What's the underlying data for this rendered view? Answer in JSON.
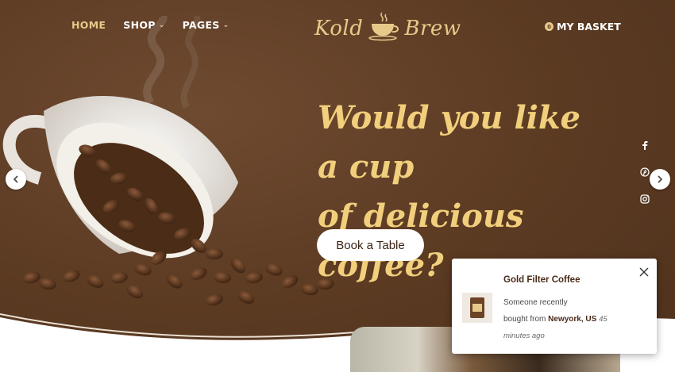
{
  "nav": {
    "items": [
      {
        "label": "HOME",
        "active": true,
        "dropdown": false
      },
      {
        "label": "SHOP",
        "active": false,
        "dropdown": true
      },
      {
        "label": "PAGES",
        "active": false,
        "dropdown": true
      }
    ]
  },
  "logo": {
    "left": "Kold",
    "right": "Brew"
  },
  "basket": {
    "count": "0",
    "label": "MY BASKET"
  },
  "hero": {
    "headline_line1": "Would you like a cup",
    "headline_line2": "of delicious coffee?",
    "cta_label": "Book a Table"
  },
  "social": [
    "facebook-icon",
    "pinterest-icon",
    "instagram-icon"
  ],
  "popup": {
    "title": "Gold Filter Coffee",
    "line1": "Someone recently",
    "line2_prefix": "bought from",
    "location": "Newyork, US",
    "time": "45 minutes ago"
  },
  "colors": {
    "background": "#5b3a22",
    "accent": "#e7c98a",
    "headline": "#f2cf7c"
  }
}
